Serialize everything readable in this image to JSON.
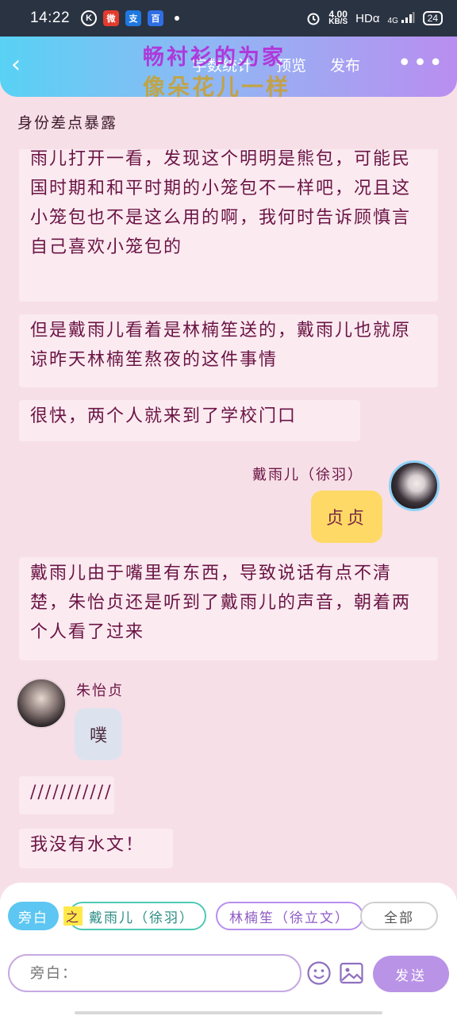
{
  "status_bar": {
    "time": "14:22",
    "apps": [
      {
        "name": "k-icon",
        "glyph": "K"
      },
      {
        "name": "weibo-icon",
        "glyph": "微"
      },
      {
        "name": "alipay-icon",
        "glyph": "支"
      },
      {
        "name": "baidu-icon",
        "glyph": "百"
      }
    ],
    "speed_value": "4.00",
    "speed_unit": "KB/S",
    "hd": "HDα",
    "network": "4G",
    "battery": "24"
  },
  "header": {
    "links": [
      "字数统计",
      "预览",
      "发布"
    ],
    "title_overlay": "畅衬衫的为家",
    "subtitle_overlay": "像朵花儿一样"
  },
  "chapter_title": "身份差点暴露",
  "messages": {
    "narr1": "雨儿打开一看，发现这个明明是熊包，可能民国时期和和平时期的小笼包不一样吧，况且这小笼包也不是这么用的啊，我何时告诉顾慎言自己喜欢小笼包的",
    "narr2": "但是戴雨儿看着是林楠笙送的，戴雨儿也就原谅昨天林楠笙熬夜的这件事情",
    "narr3": "很快，两个人就来到了学校门口",
    "speaker1_name": "戴雨儿（徐羽）",
    "speaker1_bubble": "贞贞",
    "narr4": "戴雨儿由于嘴里有东西，导致说话有点不清楚，朱怡贞还是听到了戴雨儿的声音，朝着两个人看了过来",
    "speaker2_name": "朱怡贞",
    "speaker2_bubble": "噗",
    "narr5": "///////////",
    "narr6": "我没有水文！"
  },
  "bottom": {
    "chip_narr": "旁白",
    "chip_daiyu_prefix": "之",
    "chip_daiyu": "戴雨儿（徐羽）",
    "chip_lin": "林楠笙（徐立文）",
    "chip_all": "全部",
    "input_placeholder": "旁白：",
    "send": "发送"
  },
  "colors": {
    "header_start": "#58d2f4",
    "header_end": "#b98ef0",
    "page_bg": "#f7dfe7",
    "bubble_yellow": "#ffd966",
    "send_button": "#b993e6"
  }
}
